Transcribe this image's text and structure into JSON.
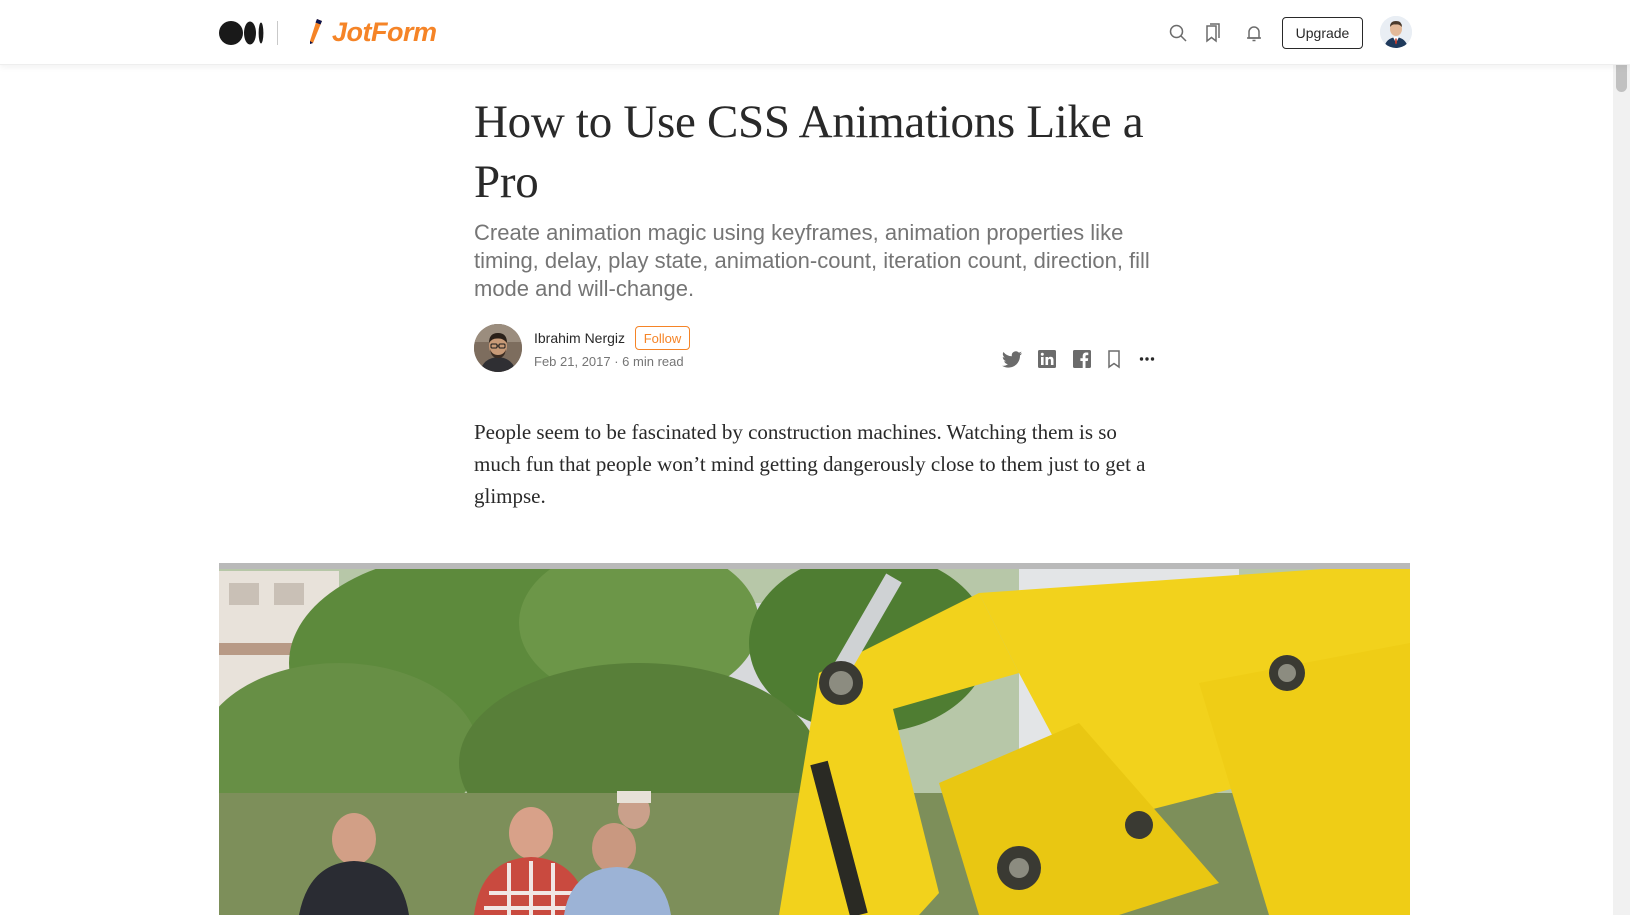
{
  "header": {
    "publication_name": "JotForm",
    "upgrade_label": "Upgrade",
    "icons": [
      "medium-logo-icon",
      "search-icon",
      "bookmarks-icon",
      "notifications-icon",
      "user-avatar"
    ]
  },
  "article": {
    "title": "How to Use CSS Animations Like a Pro",
    "subtitle": "Create animation magic using keyframes, animation properties like timing, delay, play state, animation-count, iteration count, direction, fill mode and will-change.",
    "author": {
      "name": "Ibrahim Nergiz",
      "follow_label": "Follow",
      "meta": "Feb 21, 2017 · 6 min read"
    },
    "share_icons": [
      "twitter-icon",
      "linkedin-icon",
      "facebook-icon",
      "bookmark-icon",
      "more-icon"
    ],
    "body_paragraph": "People seem to be fascinated by construction machines. Watching them is so much fun that people won’t mind getting dangerously close to them just to get a glimpse."
  },
  "colors": {
    "brand_accent": "#f58427",
    "text_primary": "#292929",
    "text_secondary": "#757575",
    "excavator_yellow": "#f2d21c"
  }
}
